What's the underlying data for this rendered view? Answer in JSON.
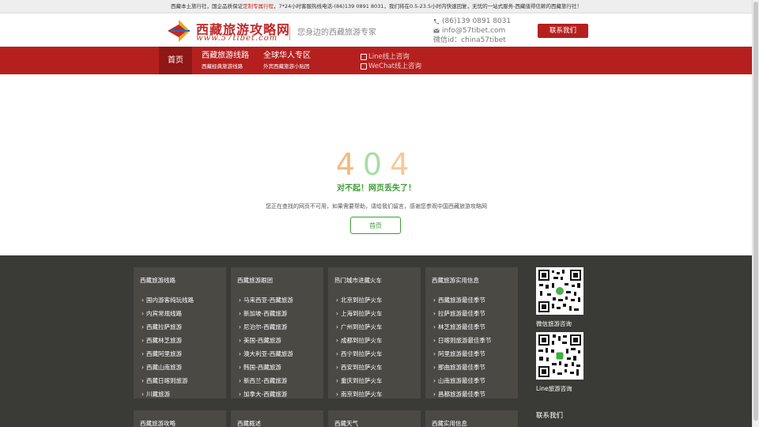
{
  "notice": {
    "part1": "西藏本土旅行社，国企品质保证",
    "highlight": "定制专属行程",
    "part2": "，7*24小时客服热线电话-(86)139 0891 8031，我们将在0.5-23.5小时内快速回复，无忧的一站式服务-西藏值得信赖的西藏旅行社！"
  },
  "header": {
    "logo_text": "西藏旅游攻略网",
    "logo_url": "www.57tibet.com",
    "tagline": "您身边的西藏旅游专家",
    "phone": "(86)139 0891 8031",
    "email": "info@57tibet.com",
    "wechat": "微信id：china57tibet",
    "contact_button": "联系我们"
  },
  "nav": {
    "home": "首页",
    "items": [
      {
        "main": "西藏旅游线路",
        "sub": "西藏经典旅游线路"
      },
      {
        "main": "全球华人专区",
        "sub": "外宾西藏旅游小贴团"
      }
    ],
    "online": [
      "Line线上咨询",
      "WeChat线上咨询"
    ]
  },
  "error": {
    "digits": [
      "4",
      "0",
      "4"
    ],
    "title": "对不起！网页丢失了！",
    "desc": "您正在查找的网页不可用，如果需要帮助，请给我们留言，感谢您参观中国西藏旅游攻略网",
    "button": "首页"
  },
  "footer": {
    "columns": [
      {
        "head": "西藏旅游线路",
        "items": [
          "国内游客纯玩线路",
          "内宾常规线路",
          "西藏拉萨旅游",
          "西藏林芝旅游",
          "西藏阿里旅游",
          "西藏山南旅游",
          "西藏日喀则旅游",
          "川藏旅游"
        ]
      },
      {
        "head": "西藏旅游跟团",
        "items": [
          "马来西亚-西藏旅游",
          "新加坡-西藏旅游",
          "尼泊尔-西藏旅游",
          "美国-西藏旅游",
          "澳大利亚-西藏旅游",
          "韩国-西藏旅游",
          "新西兰-西藏旅游",
          "加拿大-西藏旅游"
        ]
      },
      {
        "head": "热门城市进藏火车",
        "items": [
          "北京到拉萨火车",
          "上海到拉萨火车",
          "广州到拉萨火车",
          "成都到拉萨火车",
          "西宁到拉萨火车",
          "西安到拉萨火车",
          "重庆到拉萨火车",
          "南京到拉萨火车"
        ]
      },
      {
        "head": "西藏旅游实用信息",
        "items": [
          "西藏旅游最佳季节",
          "拉萨旅游最佳季节",
          "林芝旅游最佳季节",
          "日喀则旅游最佳季节",
          "阿里旅游最佳季节",
          "那曲旅游最佳季节",
          "山南旅游最佳季节",
          "昌都旅游最佳季节"
        ]
      }
    ],
    "second_row_heads": [
      "西藏旅游攻略",
      "西藏概述",
      "西藏天气",
      "西藏实用信息"
    ],
    "qr_labels": [
      "微信旅游咨询",
      "Line旅游咨询"
    ],
    "contact_us": "联系我们"
  }
}
